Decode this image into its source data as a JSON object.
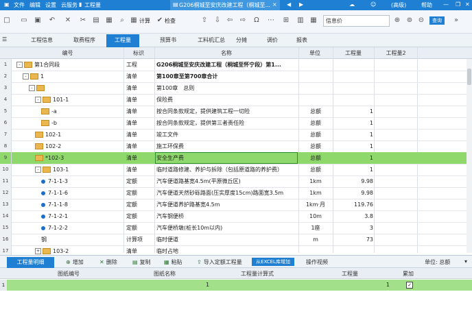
{
  "titlebar": {
    "menus": [
      "文件",
      "编辑",
      "设置",
      "云服务"
    ],
    "module": "工程量",
    "doc_tab": "G206桐城至安庆改建工程（桐城至...",
    "doc_tab_close": "×",
    "user": "(高级)",
    "help": "帮助"
  },
  "toolbar": {
    "calc_label": "计算",
    "check_label": "检查",
    "search_placeholder": "信息价",
    "blue_button": "查询"
  },
  "tabs": [
    {
      "label": "工程信息",
      "active": false
    },
    {
      "label": "取费程序",
      "active": false
    },
    {
      "label": "工程量",
      "active": true
    },
    {
      "label": "预算书",
      "active": false
    },
    {
      "label": "工料机汇总",
      "active": false
    },
    {
      "label": "分摊",
      "active": false
    },
    {
      "label": "调价",
      "active": false
    },
    {
      "label": "报表",
      "active": false
    }
  ],
  "grid": {
    "headers": {
      "code": "编号",
      "tag": "标识",
      "name": "名称",
      "unit": "单位",
      "qty": "工程量",
      "qty2": "工程量2"
    },
    "rows": [
      {
        "n": "1",
        "code": "第1合同段",
        "tag": "工程",
        "name": "G206桐城至安庆改建工程（桐城至怀宁段）第1...",
        "unit": "",
        "qty": "",
        "bold": true,
        "toggle": "-",
        "icon": "folder",
        "indent": 0
      },
      {
        "n": "2",
        "code": "1",
        "tag": "清单",
        "name": "第100章至第700章合计",
        "unit": "",
        "qty": "",
        "bold": true,
        "toggle": "-",
        "icon": "folder",
        "indent": 1
      },
      {
        "n": "3",
        "code": "",
        "tag": "清单",
        "name": "第100章　总则",
        "unit": "",
        "qty": "",
        "bold": false,
        "toggle": "-",
        "icon": "folder",
        "indent": 2
      },
      {
        "n": "4",
        "code": "101-1",
        "tag": "清单",
        "name": "保险费",
        "unit": "",
        "qty": "",
        "bold": false,
        "toggle": "-",
        "icon": "folder",
        "indent": 3
      },
      {
        "n": "5",
        "code": "-a",
        "tag": "清单",
        "name": "按合同条款规定，提供建筑工程一切险",
        "unit": "总额",
        "qty": "1",
        "bold": false,
        "toggle": "",
        "icon": "folder",
        "indent": 4
      },
      {
        "n": "6",
        "code": "-b",
        "tag": "清单",
        "name": "按合同条款规定，提供第三者责任险",
        "unit": "总额",
        "qty": "1",
        "bold": false,
        "toggle": "",
        "icon": "folder",
        "indent": 4
      },
      {
        "n": "7",
        "code": "102-1",
        "tag": "清单",
        "name": "竣工文件",
        "unit": "总额",
        "qty": "1",
        "bold": false,
        "toggle": "",
        "icon": "folder",
        "indent": 3
      },
      {
        "n": "8",
        "code": "102-2",
        "tag": "清单",
        "name": "施工环保费",
        "unit": "总额",
        "qty": "1",
        "bold": false,
        "toggle": "",
        "icon": "folder",
        "indent": 3
      },
      {
        "n": "9",
        "code": "*102-3",
        "tag": "清单",
        "name": "安全生产费",
        "unit": "总额",
        "qty": "1",
        "bold": false,
        "toggle": "",
        "icon": "folder",
        "indent": 3,
        "selected": true
      },
      {
        "n": "10",
        "code": "103-1",
        "tag": "清单",
        "name": "临时道路修建、养护与拆除（包括原道路的养护费）",
        "unit": "总额",
        "qty": "1",
        "bold": false,
        "toggle": "-",
        "icon": "folder",
        "indent": 3
      },
      {
        "n": "11",
        "code": "7-1-1-3",
        "tag": "定额",
        "name": "汽车便道路基宽4.5m(平原微丘区)",
        "unit": "1km",
        "qty": "9.98",
        "bold": false,
        "toggle": "",
        "icon": "dot",
        "indent": 4
      },
      {
        "n": "12",
        "code": "7-1-1-6",
        "tag": "定额",
        "name": "汽车便道天然砂砾路面(压实厚度15cm)路面宽3.5m",
        "unit": "1km",
        "qty": "9.98",
        "bold": false,
        "toggle": "",
        "icon": "dot",
        "indent": 4
      },
      {
        "n": "13",
        "code": "7-1-1-8",
        "tag": "定额",
        "name": "汽车便道养护路基宽4.5m",
        "unit": "1km·月",
        "qty": "119.76",
        "bold": false,
        "toggle": "",
        "icon": "dot",
        "indent": 4
      },
      {
        "n": "14",
        "code": "7-1-2-1",
        "tag": "定额",
        "name": "汽车钢便桥",
        "unit": "10m",
        "qty": "3.8",
        "bold": false,
        "toggle": "",
        "icon": "dot",
        "indent": 4
      },
      {
        "n": "15",
        "code": "7-1-2-2",
        "tag": "定额",
        "name": "汽车便桥墩(桩长10m以内)",
        "unit": "1座",
        "qty": "3",
        "bold": false,
        "toggle": "",
        "icon": "dot",
        "indent": 4
      },
      {
        "n": "16",
        "code": "钢",
        "tag": "计算项",
        "name": "临时便道",
        "unit": "m",
        "qty": "73",
        "bold": false,
        "toggle": "",
        "icon": "none",
        "indent": 4
      },
      {
        "n": "17",
        "code": "103-2",
        "tag": "清单",
        "name": "临时占地",
        "unit": "",
        "qty": "",
        "bold": false,
        "toggle": "+",
        "icon": "folder",
        "indent": 3
      }
    ]
  },
  "lower": {
    "tab": "工程量明细",
    "actions": [
      {
        "icon": "add-icon",
        "glyph": "⊕",
        "label": "增加"
      },
      {
        "icon": "delete-icon",
        "glyph": "✕",
        "label": "删除"
      },
      {
        "icon": "copy-icon",
        "glyph": "▤",
        "label": "复制"
      },
      {
        "icon": "paste-icon",
        "glyph": "▦",
        "label": "粘贴"
      },
      {
        "icon": "import-icon",
        "glyph": "⇪",
        "label": "导入定额工程量"
      }
    ],
    "excel_button": "从EXCEL库增加",
    "video": "操作视频",
    "unit_label": "单位: 总额",
    "headers": [
      "图纸编号",
      "图纸名称",
      "工程量计算式",
      "工程量",
      "累加"
    ],
    "row": {
      "n": "1",
      "drawing_no": "",
      "drawing_name": "",
      "formula": "1",
      "qty": "1",
      "accumulate": "✓"
    }
  }
}
